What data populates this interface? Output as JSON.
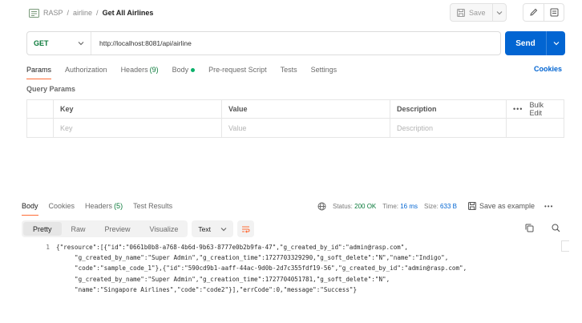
{
  "breadcrumb": {
    "workspace": "RASP",
    "collection": "airline",
    "request": "Get All Airlines",
    "separator": "/"
  },
  "toolbar": {
    "save_label": "Save"
  },
  "request": {
    "method": "GET",
    "url": "http://localhost:8081/api/airline",
    "send_label": "Send"
  },
  "tabs": [
    {
      "label": "Params"
    },
    {
      "label": "Authorization"
    },
    {
      "label": "Headers",
      "count": "(9)"
    },
    {
      "label": "Body"
    },
    {
      "label": "Pre-request Script"
    },
    {
      "label": "Tests"
    },
    {
      "label": "Settings"
    }
  ],
  "cookies_label": "Cookies",
  "query_params": {
    "title": "Query Params",
    "headers": {
      "key": "Key",
      "value": "Value",
      "description": "Description",
      "bulk_edit": "Bulk Edit"
    },
    "placeholder": {
      "key": "Key",
      "value": "Value",
      "description": "Description"
    }
  },
  "response": {
    "tabs": [
      {
        "label": "Body"
      },
      {
        "label": "Cookies"
      },
      {
        "label": "Headers",
        "count": "(5)"
      },
      {
        "label": "Test Results"
      }
    ],
    "status_label": "Status:",
    "status_value": "200 OK",
    "time_label": "Time:",
    "time_value": "16 ms",
    "size_label": "Size:",
    "size_value": "633 B",
    "save_example": "Save as example",
    "views": [
      "Pretty",
      "Raw",
      "Preview",
      "Visualize"
    ],
    "format": "Text",
    "line_number": "1",
    "lines": [
      "{\"resource\":[{\"id\":\"0661b0b8-a768-4b6d-9b63-8777e0b2b9fa-47\",\"g_created_by_id\":\"admin@rasp.com\",",
      "\"g_created_by_name\":\"Super Admin\",\"g_creation_time\":1727703329290,\"g_soft_delete\":\"N\",\"name\":\"Indigo\",",
      "\"code\":\"sample_code_1\"},{\"id\":\"590cd9b1-aaff-44ac-9d0b-2d7c355fdf19-56\",\"g_created_by_id\":\"admin@rasp.com\",",
      "\"g_created_by_name\":\"Super Admin\",\"g_creation_time\":1727704051781,\"g_soft_delete\":\"N\",",
      "\"name\":\"Singapore Airlines\",\"code\":\"code2\"}],\"errCode\":0,\"message\":\"Success\"}"
    ]
  },
  "colors": {
    "accent": "#ff6c37",
    "send": "#0265d2",
    "method": "#0a7a3a",
    "status_ok": "#0a7a3a"
  }
}
